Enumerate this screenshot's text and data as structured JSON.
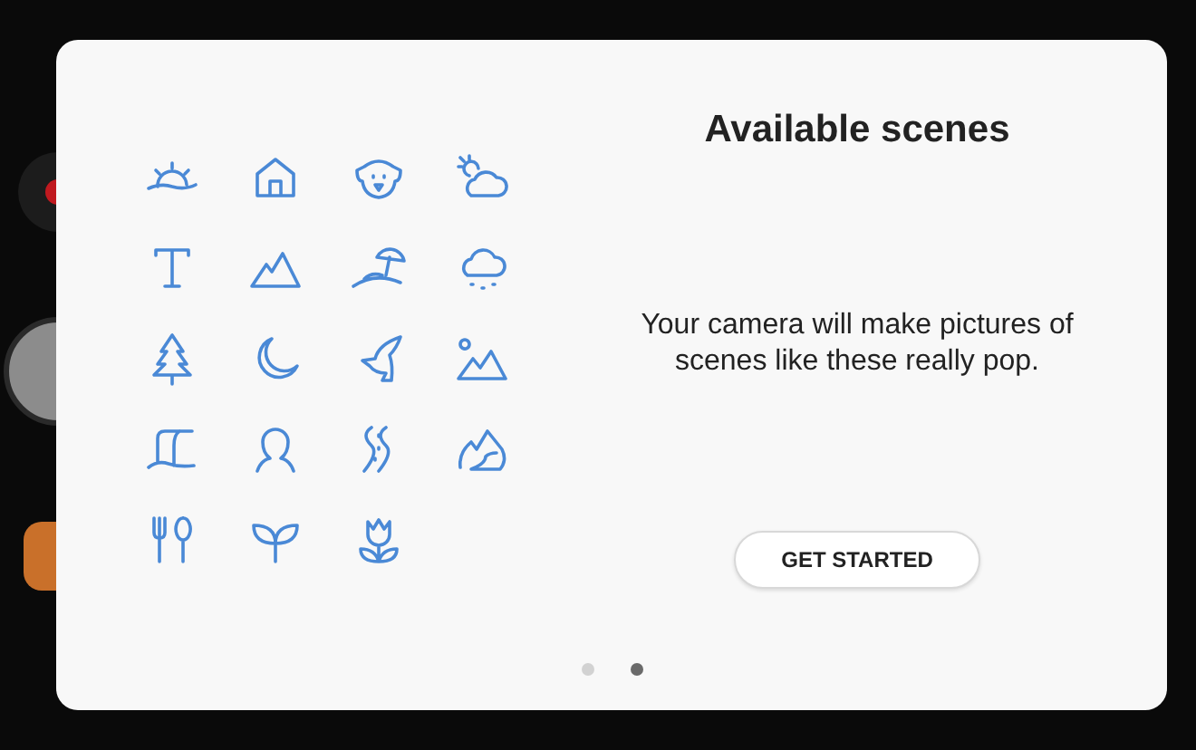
{
  "dialog": {
    "title": "Available scenes",
    "message": "Your camera will make pictures of scenes like these really pop.",
    "button": "GET STARTED",
    "page_dots": [
      {
        "selected": false
      },
      {
        "selected": true
      }
    ]
  }
}
